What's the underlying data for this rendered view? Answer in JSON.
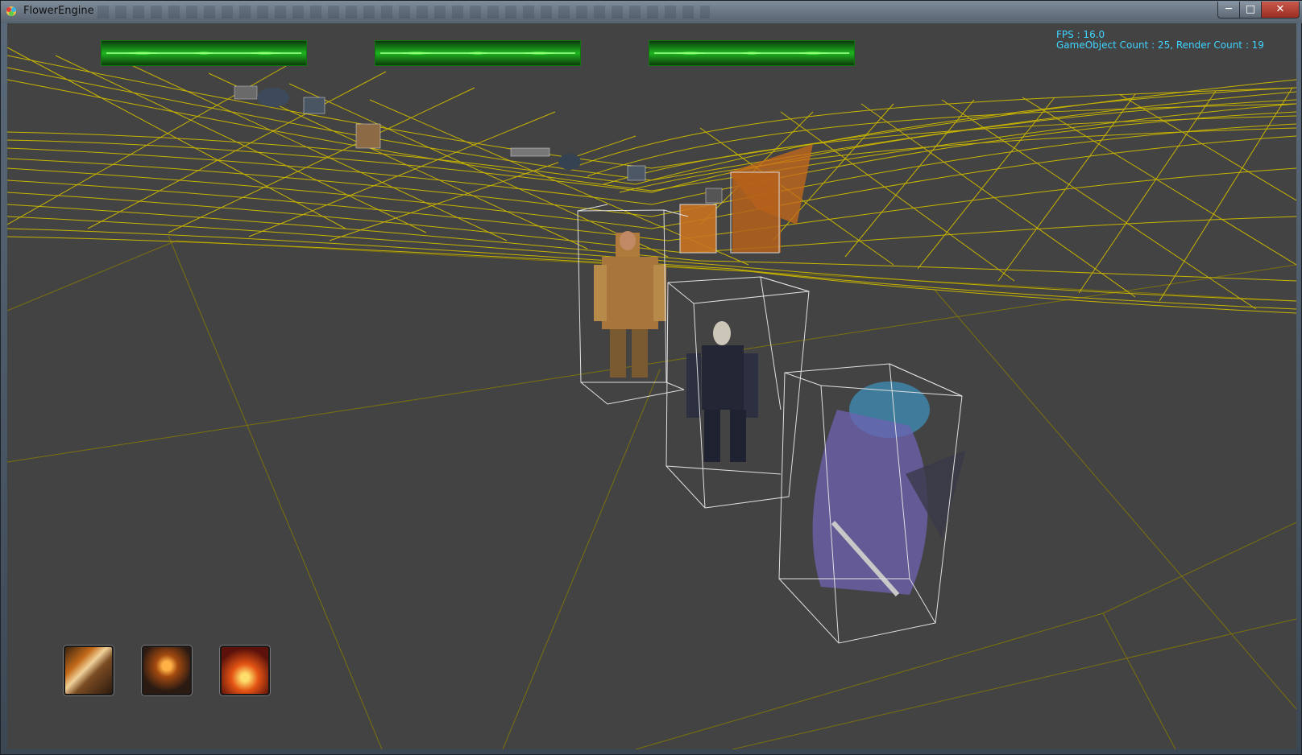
{
  "window": {
    "title": "FlowerEngine",
    "controls": {
      "minimize": "─",
      "maximize": "□",
      "close": "✕"
    }
  },
  "hud": {
    "fps_text": "FPS : 16.0",
    "count_text": "GameObject Count : 25, Render Count : 19"
  },
  "health_bars": [
    {
      "name": "unit-1-health",
      "fill": 1.0
    },
    {
      "name": "unit-2-health",
      "fill": 1.0
    },
    {
      "name": "unit-3-health",
      "fill": 1.0
    }
  ],
  "skills": [
    {
      "name": "skill-slot-1",
      "icon": "blade-strike-icon"
    },
    {
      "name": "skill-slot-2",
      "icon": "dark-blade-icon"
    },
    {
      "name": "skill-slot-3",
      "icon": "fire-shield-icon"
    }
  ],
  "colors": {
    "viewport_bg": "#434343",
    "wireframe": "#c8b400",
    "hud_text": "#3fd4ff",
    "health_green": "#1fb51f",
    "bounding_box": "#d8d8d8"
  }
}
